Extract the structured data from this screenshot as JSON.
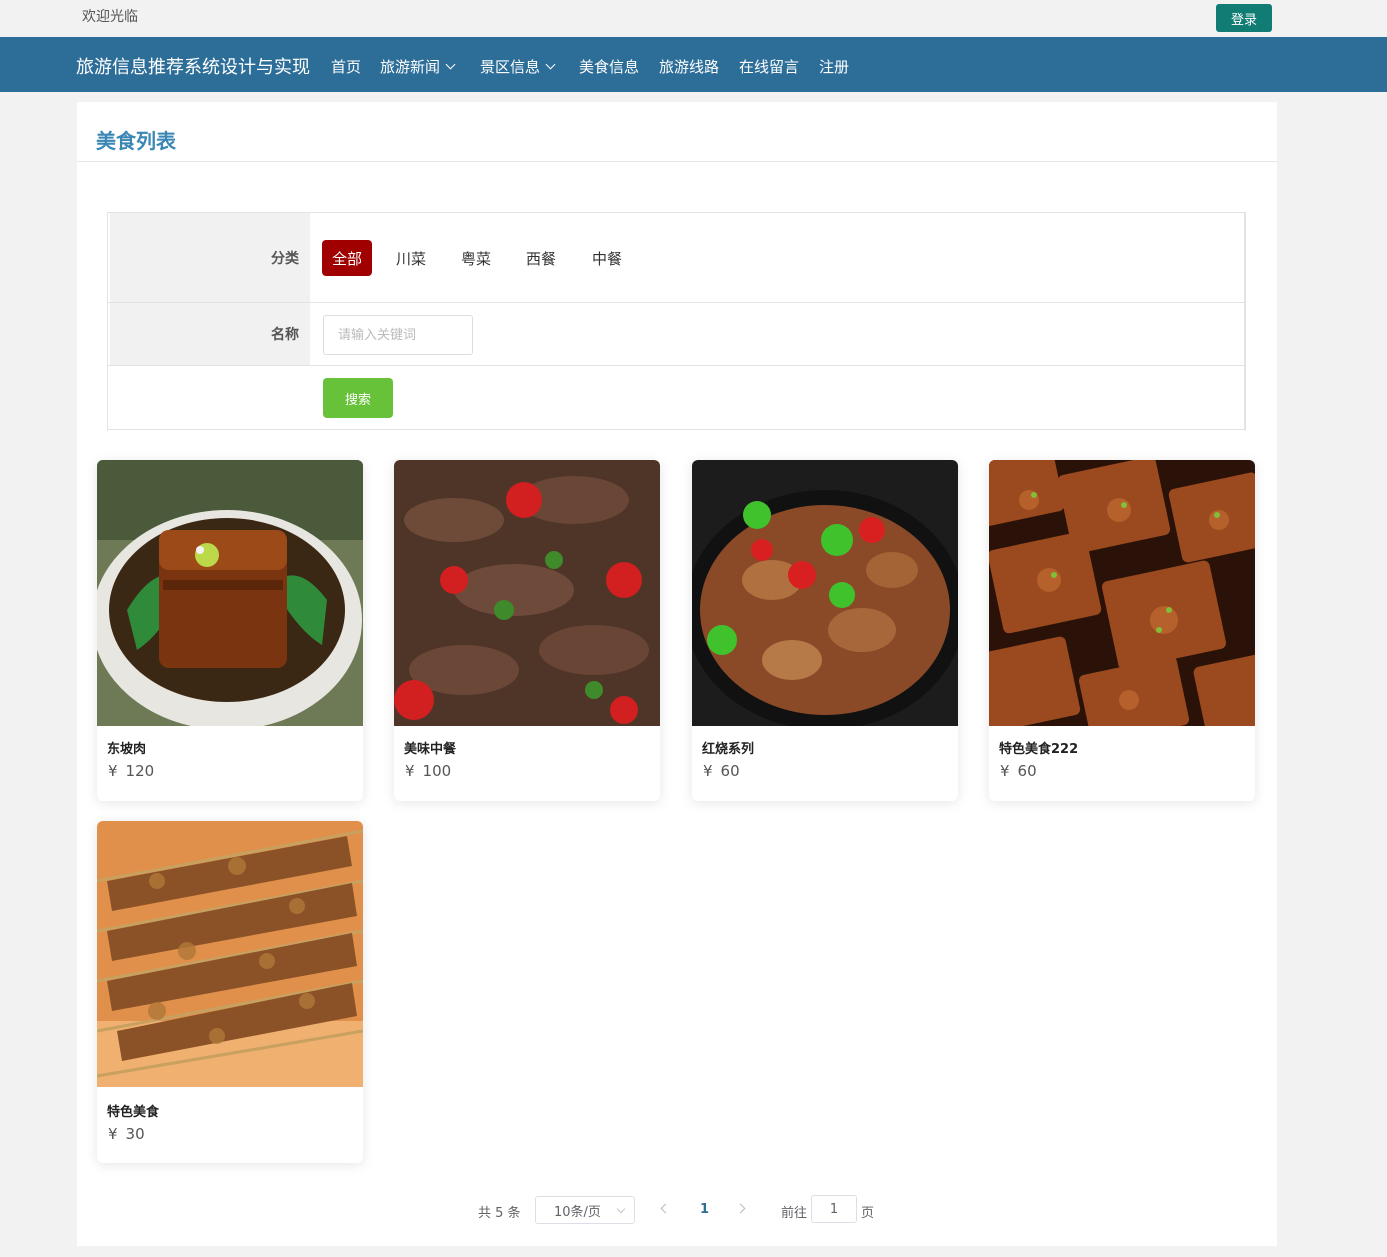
{
  "topbar": {
    "welcome": "欢迎光临",
    "login_label": "登录",
    "login_color": "#117c74"
  },
  "nav": {
    "brand": "旅游信息推荐系统设计与实现",
    "items": [
      {
        "label": "首页",
        "has_dropdown": false
      },
      {
        "label": "旅游新闻",
        "has_dropdown": true
      },
      {
        "label": "景区信息",
        "has_dropdown": true
      },
      {
        "label": "美食信息",
        "has_dropdown": false
      },
      {
        "label": "旅游线路",
        "has_dropdown": false
      },
      {
        "label": "在线留言",
        "has_dropdown": false
      },
      {
        "label": "注册",
        "has_dropdown": false
      }
    ],
    "bg_color": "#2d6e99"
  },
  "page": {
    "title": "美食列表"
  },
  "filter": {
    "category_label": "分类",
    "categories": [
      {
        "label": "全部",
        "active": true
      },
      {
        "label": "川菜",
        "active": false
      },
      {
        "label": "粤菜",
        "active": false
      },
      {
        "label": "西餐",
        "active": false
      },
      {
        "label": "中餐",
        "active": false
      }
    ],
    "name_label": "名称",
    "name_placeholder": "请输入关键词",
    "name_value": "",
    "search_label": "搜索",
    "active_color": "#a00000",
    "search_color": "#67c23a"
  },
  "foods": [
    {
      "name": "东坡肉",
      "currency": "¥",
      "price": "120",
      "image": "braised-pork-photo"
    },
    {
      "name": "美味中餐",
      "currency": "¥",
      "price": "100",
      "image": "stir-fried-beef-peppers-photo"
    },
    {
      "name": "红烧系列",
      "currency": "¥",
      "price": "60",
      "image": "braised-intestines-peppers-photo"
    },
    {
      "name": "特色美食222",
      "currency": "¥",
      "price": "60",
      "image": "braised-tofu-photo"
    },
    {
      "name": "特色美食",
      "currency": "¥",
      "price": "30",
      "image": "lamb-skewers-photo"
    }
  ],
  "pagination": {
    "total": "共 5 条",
    "page_size": "10条/页",
    "current_page": "1",
    "goto_label": "前往",
    "goto_value": "1",
    "page_suffix": "页"
  }
}
